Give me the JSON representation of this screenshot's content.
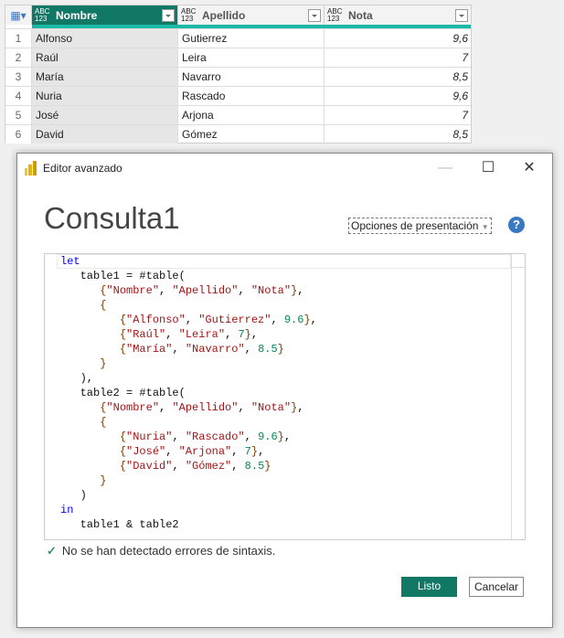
{
  "grid": {
    "columns": [
      {
        "type": "ABC\n123",
        "name": "Nombre"
      },
      {
        "type": "ABC\n123",
        "name": "Apellido"
      },
      {
        "type": "ABC\n123",
        "name": "Nota"
      }
    ],
    "rows": [
      [
        "1",
        "Alfonso",
        "Gutierrez",
        "9,6"
      ],
      [
        "2",
        "Raúl",
        "Leira",
        "7"
      ],
      [
        "3",
        "María",
        "Navarro",
        "8,5"
      ],
      [
        "4",
        "Nuria",
        "Rascado",
        "9,6"
      ],
      [
        "5",
        "José",
        "Arjona",
        "7"
      ],
      [
        "6",
        "David",
        "Gómez",
        "8,5"
      ]
    ]
  },
  "dialog": {
    "title": "Editor avanzado",
    "query_name": "Consulta1",
    "options_label": "Opciones de presentación",
    "help": "?",
    "status": "No se han detectado errores de sintaxis.",
    "ok": "Listo",
    "cancel": "Cancelar"
  },
  "editor": {
    "lines": [
      [
        [
          "kw",
          "let"
        ]
      ],
      [
        [
          "pl",
          "   table1 = #table("
        ]
      ],
      [
        [
          "pl",
          "      "
        ],
        [
          "br",
          "{"
        ],
        [
          "str",
          "\"Nombre\""
        ],
        [
          "pl",
          ", "
        ],
        [
          "str",
          "\"Apellido\""
        ],
        [
          "pl",
          ", "
        ],
        [
          "str",
          "\"Nota\""
        ],
        [
          "br",
          "}"
        ],
        [
          "pl",
          ","
        ]
      ],
      [
        [
          "pl",
          "      "
        ],
        [
          "br",
          "{"
        ]
      ],
      [
        [
          "pl",
          "         "
        ],
        [
          "br",
          "{"
        ],
        [
          "str",
          "\"Alfonso\""
        ],
        [
          "pl",
          ", "
        ],
        [
          "str",
          "\"Gutierrez\""
        ],
        [
          "pl",
          ", "
        ],
        [
          "num",
          "9.6"
        ],
        [
          "br",
          "}"
        ],
        [
          "pl",
          ","
        ]
      ],
      [
        [
          "pl",
          "         "
        ],
        [
          "br",
          "{"
        ],
        [
          "str",
          "\"Raúl\""
        ],
        [
          "pl",
          ", "
        ],
        [
          "str",
          "\"Leira\""
        ],
        [
          "pl",
          ", "
        ],
        [
          "num",
          "7"
        ],
        [
          "br",
          "}"
        ],
        [
          "pl",
          ","
        ]
      ],
      [
        [
          "pl",
          "         "
        ],
        [
          "br",
          "{"
        ],
        [
          "str",
          "\"María\""
        ],
        [
          "pl",
          ", "
        ],
        [
          "str",
          "\"Navarro\""
        ],
        [
          "pl",
          ", "
        ],
        [
          "num",
          "8.5"
        ],
        [
          "br",
          "}"
        ]
      ],
      [
        [
          "pl",
          "      "
        ],
        [
          "br",
          "}"
        ]
      ],
      [
        [
          "pl",
          "   ),"
        ]
      ],
      [
        [
          "pl",
          "   table2 = #table("
        ]
      ],
      [
        [
          "pl",
          "      "
        ],
        [
          "br",
          "{"
        ],
        [
          "str",
          "\"Nombre\""
        ],
        [
          "pl",
          ", "
        ],
        [
          "str",
          "\"Apellido\""
        ],
        [
          "pl",
          ", "
        ],
        [
          "str",
          "\"Nota\""
        ],
        [
          "br",
          "}"
        ],
        [
          "pl",
          ","
        ]
      ],
      [
        [
          "pl",
          "      "
        ],
        [
          "br",
          "{"
        ]
      ],
      [
        [
          "pl",
          "         "
        ],
        [
          "br",
          "{"
        ],
        [
          "str",
          "\"Nuria\""
        ],
        [
          "pl",
          ", "
        ],
        [
          "str",
          "\"Rascado\""
        ],
        [
          "pl",
          ", "
        ],
        [
          "num",
          "9.6"
        ],
        [
          "br",
          "}"
        ],
        [
          "pl",
          ","
        ]
      ],
      [
        [
          "pl",
          "         "
        ],
        [
          "br",
          "{"
        ],
        [
          "str",
          "\"José\""
        ],
        [
          "pl",
          ", "
        ],
        [
          "str",
          "\"Arjona\""
        ],
        [
          "pl",
          ", "
        ],
        [
          "num",
          "7"
        ],
        [
          "br",
          "}"
        ],
        [
          "pl",
          ","
        ]
      ],
      [
        [
          "pl",
          "         "
        ],
        [
          "br",
          "{"
        ],
        [
          "str",
          "\"David\""
        ],
        [
          "pl",
          ", "
        ],
        [
          "str",
          "\"Gómez\""
        ],
        [
          "pl",
          ", "
        ],
        [
          "num",
          "8.5"
        ],
        [
          "br",
          "}"
        ]
      ],
      [
        [
          "pl",
          "      "
        ],
        [
          "br",
          "}"
        ]
      ],
      [
        [
          "pl",
          "   )"
        ]
      ],
      [
        [
          "kw",
          "in"
        ]
      ],
      [
        [
          "pl",
          "   table1 & table2"
        ]
      ]
    ]
  }
}
